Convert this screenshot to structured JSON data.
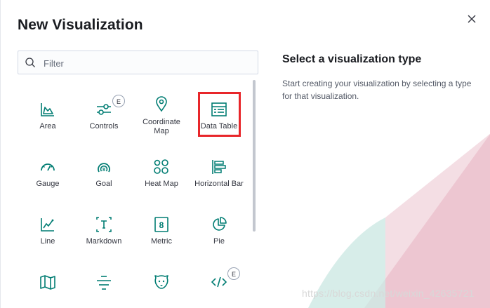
{
  "modal": {
    "title": "New Visualization",
    "close_label": "×"
  },
  "search": {
    "placeholder": "Filter",
    "value": ""
  },
  "visualizations": [
    {
      "label": "Area",
      "icon": "area-chart-icon",
      "badge": ""
    },
    {
      "label": "Controls",
      "icon": "controls-icon",
      "badge": "E"
    },
    {
      "label": "Coordinate Map",
      "icon": "map-marker-icon",
      "badge": ""
    },
    {
      "label": "Data Table",
      "icon": "data-table-icon",
      "badge": ""
    },
    {
      "label": "Gauge",
      "icon": "gauge-icon",
      "badge": ""
    },
    {
      "label": "Goal",
      "icon": "goal-icon",
      "badge": ""
    },
    {
      "label": "Heat Map",
      "icon": "heat-map-icon",
      "badge": ""
    },
    {
      "label": "Horizontal Bar",
      "icon": "horizontal-bar-icon",
      "badge": ""
    },
    {
      "label": "Line",
      "icon": "line-chart-icon",
      "badge": ""
    },
    {
      "label": "Markdown",
      "icon": "markdown-icon",
      "badge": ""
    },
    {
      "label": "Metric",
      "icon": "metric-icon",
      "badge": ""
    },
    {
      "label": "Pie",
      "icon": "pie-chart-icon",
      "badge": ""
    },
    {
      "label": "",
      "icon": "region-map-icon",
      "badge": ""
    },
    {
      "label": "",
      "icon": "tag-cloud-icon",
      "badge": ""
    },
    {
      "label": "",
      "icon": "timelion-icon",
      "badge": ""
    },
    {
      "label": "",
      "icon": "vega-icon",
      "badge": "E"
    }
  ],
  "selected": "Data Table",
  "info": {
    "heading": "Select a visualization type",
    "description": "Start creating your visualization by selecting a type for that visualization."
  },
  "watermark": "https://blog.csdn.net/weixin_42635721",
  "colors": {
    "accent": "#017d73",
    "highlight": "#e8262a",
    "decor_pink": "#e9b9c6",
    "decor_teal": "#cde8e4"
  }
}
